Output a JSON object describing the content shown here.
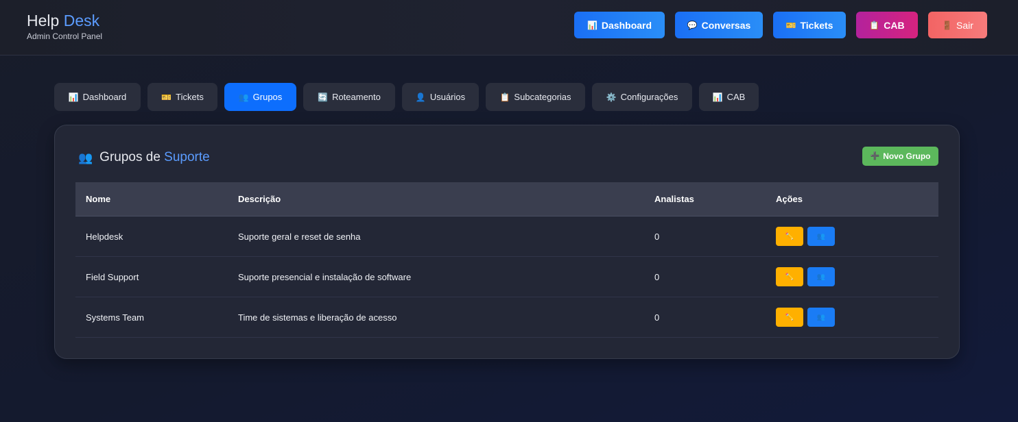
{
  "brand": {
    "title_a": "Help ",
    "title_b": "Desk",
    "subtitle": "Admin Control Panel"
  },
  "header_buttons": [
    {
      "icon": "📊",
      "label": "Dashboard"
    },
    {
      "icon": "💬",
      "label": "Conversas"
    },
    {
      "icon": "🎫",
      "label": "Tickets"
    },
    {
      "icon": "📋",
      "label": "CAB"
    },
    {
      "icon": "🚪",
      "label": "Sair"
    }
  ],
  "tabs": [
    {
      "icon": "📊",
      "label": "Dashboard"
    },
    {
      "icon": "🎫",
      "label": "Tickets"
    },
    {
      "icon": "👥",
      "label": "Grupos"
    },
    {
      "icon": "🔄",
      "label": "Roteamento"
    },
    {
      "icon": "👤",
      "label": "Usuários"
    },
    {
      "icon": "📋",
      "label": "Subcategorias"
    },
    {
      "icon": "⚙️",
      "label": "Configurações"
    },
    {
      "icon": "📊",
      "label": "CAB"
    }
  ],
  "card": {
    "icon": "👥",
    "title_a": "Grupos de ",
    "title_b": "Suporte",
    "new_button": {
      "icon": "➕",
      "label": "Novo Grupo"
    }
  },
  "table": {
    "headers": [
      "Nome",
      "Descrição",
      "Analistas",
      "Ações"
    ],
    "rows": [
      {
        "name": "Helpdesk",
        "description": "Suporte geral e reset de senha",
        "analysts": "0"
      },
      {
        "name": "Field Support",
        "description": "Suporte presencial e instalação de software",
        "analysts": "0"
      },
      {
        "name": "Systems Team",
        "description": "Time de sistemas e liberação de acesso",
        "analysts": "0"
      }
    ],
    "action_icons": {
      "edit": "✏️",
      "members": "👥"
    }
  },
  "colors": {
    "accent": "#5b9cff",
    "active_tab": "#0d6efd",
    "success": "#5cb85c",
    "warning": "#ffb000"
  }
}
